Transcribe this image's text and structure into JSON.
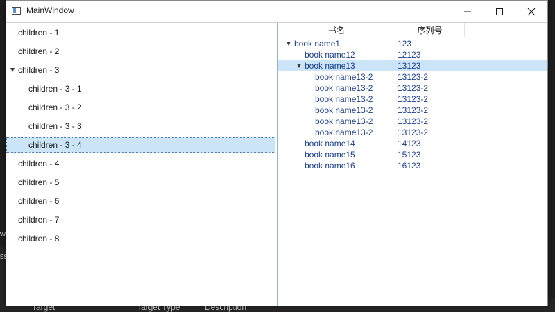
{
  "window": {
    "title": "MainWindow"
  },
  "left_tree": {
    "items": [
      {
        "label": "children - 1"
      },
      {
        "label": "children - 2"
      },
      {
        "label": "children - 3"
      },
      {
        "label": "children - 3 - 1"
      },
      {
        "label": "children - 3 - 2"
      },
      {
        "label": "children - 3 - 3"
      },
      {
        "label": "children - 3 - 4"
      },
      {
        "label": "children - 4"
      },
      {
        "label": "children - 5"
      },
      {
        "label": "children - 6"
      },
      {
        "label": "children - 7"
      },
      {
        "label": "children - 8"
      }
    ]
  },
  "right_grid": {
    "columns": [
      "书名",
      "序列号"
    ],
    "rows": [
      {
        "name": "book name1",
        "serial": "123"
      },
      {
        "name": "book name12",
        "serial": "12123"
      },
      {
        "name": "book name13",
        "serial": "13123"
      },
      {
        "name": "book name13-2",
        "serial": "13123-2"
      },
      {
        "name": "book name13-2",
        "serial": "13123-2"
      },
      {
        "name": "book name13-2",
        "serial": "13123-2"
      },
      {
        "name": "book name13-2",
        "serial": "13123-2"
      },
      {
        "name": "book name13-2",
        "serial": "13123-2"
      },
      {
        "name": "book name13-2",
        "serial": "13123-2"
      },
      {
        "name": "book name14",
        "serial": "14123"
      },
      {
        "name": "book name15",
        "serial": "15123"
      },
      {
        "name": "book name16",
        "serial": "16123"
      }
    ]
  },
  "background": {
    "col1": "Target",
    "col2": "Target Type",
    "col3": "Description",
    "edge1": "w",
    "edge2": "ss"
  }
}
